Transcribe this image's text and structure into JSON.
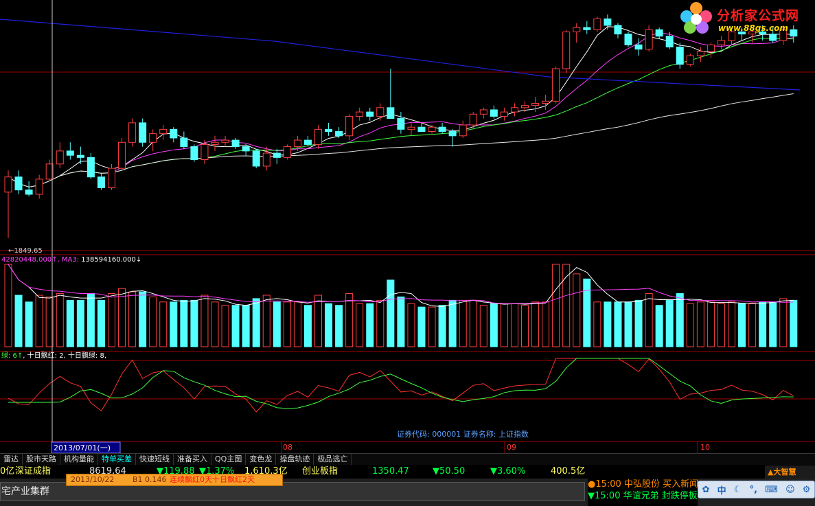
{
  "window": {
    "title": "大智慧"
  },
  "logo": {
    "title": "分析家公式网",
    "url": "www.88gs.com"
  },
  "price_panel": {
    "low_marker": "←1849.65",
    "info_label": "证券代码: 000001  证券名称: 上证指数"
  },
  "volume_panel": {
    "header_parts": [
      "42820448.000↑, ",
      "MA3: ",
      "138594160.000↓"
    ]
  },
  "indicator_panel": {
    "header_parts": [
      "绿: 6↑",
      ", 十日飘红: 2",
      ", 十日飘绿: 8",
      ","
    ]
  },
  "time_axis": {
    "cursor_date": "2013/07/01(一)",
    "month_labels": [
      "08",
      "09",
      "10"
    ]
  },
  "tabs": [
    {
      "label": "雷达",
      "active": false
    },
    {
      "label": "股市天路",
      "active": false
    },
    {
      "label": "机构量能",
      "active": false
    },
    {
      "label": "特单买差",
      "active": true
    },
    {
      "label": "快速短线",
      "active": false
    },
    {
      "label": "准备买入",
      "active": false
    },
    {
      "label": "QQ主图",
      "active": false
    },
    {
      "label": "变色龙",
      "active": false
    },
    {
      "label": "操盘轨迹",
      "active": false
    },
    {
      "label": "极品逃亡",
      "active": false
    }
  ],
  "ticker": {
    "prefix": "0亿",
    "index1_name": "深证成指",
    "index1_value": "8619.64",
    "index1_change": "▼119.88",
    "index1_pct": "▼1.37%",
    "index1_amount": "1,610.3亿",
    "index2_name": "创业板指",
    "index2_value": "1350.47",
    "index2_change": "▼50.50",
    "index2_pct": "▼3.60%",
    "index2_amount": "400.5亿"
  },
  "cursor_tooltip": {
    "date": "2013/10/22",
    "signal": "B1 0.146",
    "red_text": "连续飘红0天十日飘红2天"
  },
  "sector": {
    "label": "宅产业集群"
  },
  "news": [
    {
      "time": "●15:00",
      "text": "中弘股份 买入新闻"
    },
    {
      "time": "▼15:00",
      "text": "华谊兄弟 封跌停板"
    }
  ],
  "ime": {
    "mode": "中"
  },
  "colors": {
    "background": "#000000",
    "up_candle": "#ff4040",
    "down_candle": "#54ffff",
    "panel_border": "#a00000",
    "ma_white": "#ffffff",
    "ma_magenta": "#ff40ff",
    "ma_green": "#40ff40",
    "ma_blue": "#2020e0",
    "ticker_yellow": "#ffff60",
    "ticker_green": "#00ff40",
    "tab_active": "#00ffff",
    "tooltip_bg": "#f7a12a"
  },
  "chart_data": {
    "type": "candlestick",
    "series": [
      {
        "name": "K线",
        "ohlc": [
          [
            1955,
            2005,
            1849,
            1990
          ],
          [
            1990,
            2005,
            1950,
            1960
          ],
          [
            1960,
            1980,
            1945,
            1950
          ],
          [
            1950,
            1995,
            1940,
            1985
          ],
          [
            1985,
            2030,
            1980,
            2020
          ],
          [
            2020,
            2070,
            2010,
            2050
          ],
          [
            2050,
            2070,
            2030,
            2040
          ],
          [
            2040,
            2060,
            2020,
            2035
          ],
          [
            2035,
            2045,
            1985,
            1990
          ],
          [
            1990,
            2000,
            1960,
            1965
          ],
          [
            1965,
            2020,
            1960,
            2010
          ],
          [
            2010,
            2080,
            2005,
            2070
          ],
          [
            2070,
            2125,
            2060,
            2115
          ],
          [
            2115,
            2125,
            2060,
            2070
          ],
          [
            2070,
            2100,
            2050,
            2090
          ],
          [
            2090,
            2110,
            2075,
            2100
          ],
          [
            2100,
            2105,
            2070,
            2080
          ],
          [
            2080,
            2095,
            2055,
            2060
          ],
          [
            2060,
            2065,
            2025,
            2030
          ],
          [
            2030,
            2075,
            2020,
            2065
          ],
          [
            2065,
            2085,
            2050,
            2070
          ],
          [
            2070,
            2085,
            2060,
            2075
          ],
          [
            2075,
            2080,
            2055,
            2060
          ],
          [
            2060,
            2065,
            2040,
            2050
          ],
          [
            2050,
            2055,
            2010,
            2015
          ],
          [
            2015,
            2060,
            2005,
            2045
          ],
          [
            2045,
            2055,
            2020,
            2035
          ],
          [
            2035,
            2065,
            2030,
            2060
          ],
          [
            2060,
            2085,
            2050,
            2075
          ],
          [
            2075,
            2085,
            2060,
            2065
          ],
          [
            2065,
            2110,
            2055,
            2100
          ],
          [
            2100,
            2115,
            2085,
            2095
          ],
          [
            2095,
            2105,
            2080,
            2085
          ],
          [
            2085,
            2135,
            2075,
            2130
          ],
          [
            2130,
            2150,
            2120,
            2140
          ],
          [
            2140,
            2150,
            2120,
            2130
          ],
          [
            2130,
            2160,
            2120,
            2150
          ],
          [
            2150,
            2240,
            2140,
            2125
          ],
          [
            2125,
            2140,
            2090,
            2100
          ],
          [
            2100,
            2115,
            2085,
            2105
          ],
          [
            2105,
            2115,
            2095,
            2095
          ],
          [
            2095,
            2110,
            2090,
            2105
          ],
          [
            2105,
            2115,
            2090,
            2095
          ],
          [
            2095,
            2100,
            2060,
            2085
          ],
          [
            2085,
            2120,
            2080,
            2110
          ],
          [
            2110,
            2140,
            2100,
            2135
          ],
          [
            2135,
            2150,
            2125,
            2145
          ],
          [
            2145,
            2155,
            2125,
            2130
          ],
          [
            2130,
            2150,
            2120,
            2140
          ],
          [
            2140,
            2160,
            2130,
            2150
          ],
          [
            2150,
            2165,
            2140,
            2155
          ],
          [
            2155,
            2175,
            2140,
            2160
          ],
          [
            2160,
            2180,
            2145,
            2165
          ],
          [
            2165,
            2245,
            2160,
            2240
          ],
          [
            2240,
            2330,
            2230,
            2325
          ],
          [
            2325,
            2345,
            2300,
            2335
          ],
          [
            2335,
            2350,
            2320,
            2330
          ],
          [
            2330,
            2360,
            2325,
            2355
          ],
          [
            2355,
            2365,
            2330,
            2340
          ],
          [
            2340,
            2345,
            2310,
            2320
          ],
          [
            2320,
            2325,
            2290,
            2295
          ],
          [
            2295,
            2310,
            2270,
            2285
          ],
          [
            2285,
            2340,
            2280,
            2330
          ],
          [
            2330,
            2335,
            2310,
            2315
          ],
          [
            2315,
            2325,
            2285,
            2290
          ],
          [
            2290,
            2300,
            2240,
            2250
          ],
          [
            2250,
            2275,
            2245,
            2270
          ],
          [
            2270,
            2290,
            2255,
            2280
          ],
          [
            2280,
            2300,
            2265,
            2295
          ],
          [
            2295,
            2315,
            2285,
            2305
          ],
          [
            2305,
            2330,
            2295,
            2325
          ],
          [
            2325,
            2335,
            2305,
            2320
          ],
          [
            2320,
            2330,
            2300,
            2325
          ],
          [
            2325,
            2340,
            2305,
            2320
          ],
          [
            2320,
            2335,
            2300,
            2305
          ],
          [
            2305,
            2340,
            2295,
            2330
          ],
          [
            2330,
            2340,
            2300,
            2315
          ]
        ]
      }
    ],
    "low_label": "1849.65",
    "x_month_labels": [
      "08",
      "09",
      "10"
    ]
  }
}
